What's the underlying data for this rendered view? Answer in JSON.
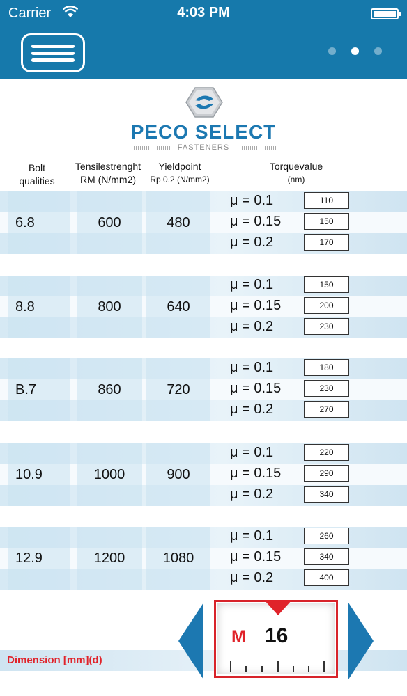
{
  "status": {
    "carrier": "Carrier",
    "time": "4:03 PM"
  },
  "brand": {
    "name": "PECO SELECT",
    "sub": "FASTENERS"
  },
  "headers": {
    "bolt_line1": "Bolt",
    "bolt_line2": "qualities",
    "tensile_line1": "Tensilestrenght",
    "tensile_line2": "RM (N/mm2)",
    "yield_line1": "Yieldpoint",
    "yield_line2": "Rp 0.2 (N/mm2)",
    "torque_line1": "Torquevalue",
    "torque_line2": "(nm)"
  },
  "rows": [
    {
      "quality": "6.8",
      "tensile": "600",
      "yield": "480",
      "mu": [
        "μ = 0.1",
        "μ = 0.15",
        "μ = 0.2"
      ],
      "torque": [
        "110",
        "150",
        "170"
      ]
    },
    {
      "quality": "8.8",
      "tensile": "800",
      "yield": "640",
      "mu": [
        "μ = 0.1",
        "μ = 0.15",
        "μ = 0.2"
      ],
      "torque": [
        "150",
        "200",
        "230"
      ]
    },
    {
      "quality": "B.7",
      "tensile": "860",
      "yield": "720",
      "mu": [
        "μ = 0.1",
        "μ = 0.15",
        "μ = 0.2"
      ],
      "torque": [
        "180",
        "230",
        "270"
      ]
    },
    {
      "quality": "10.9",
      "tensile": "1000",
      "yield": "900",
      "mu": [
        "μ = 0.1",
        "μ = 0.15",
        "μ = 0.2"
      ],
      "torque": [
        "220",
        "290",
        "340"
      ]
    },
    {
      "quality": "12.9",
      "tensile": "1200",
      "yield": "1080",
      "mu": [
        "μ = 0.1",
        "μ = 0.15",
        "μ = 0.2"
      ],
      "torque": [
        "260",
        "340",
        "400"
      ]
    }
  ],
  "dimension": {
    "label": "Dimension [mm](d)",
    "unit": "M",
    "value": "16"
  },
  "colors": {
    "primary": "#1679ab",
    "accent": "#e0232a",
    "brand": "#1c78b1"
  },
  "icons": {
    "menu": "hamburger-menu-icon",
    "left": "triangle-left-icon",
    "right": "triangle-right-icon"
  }
}
